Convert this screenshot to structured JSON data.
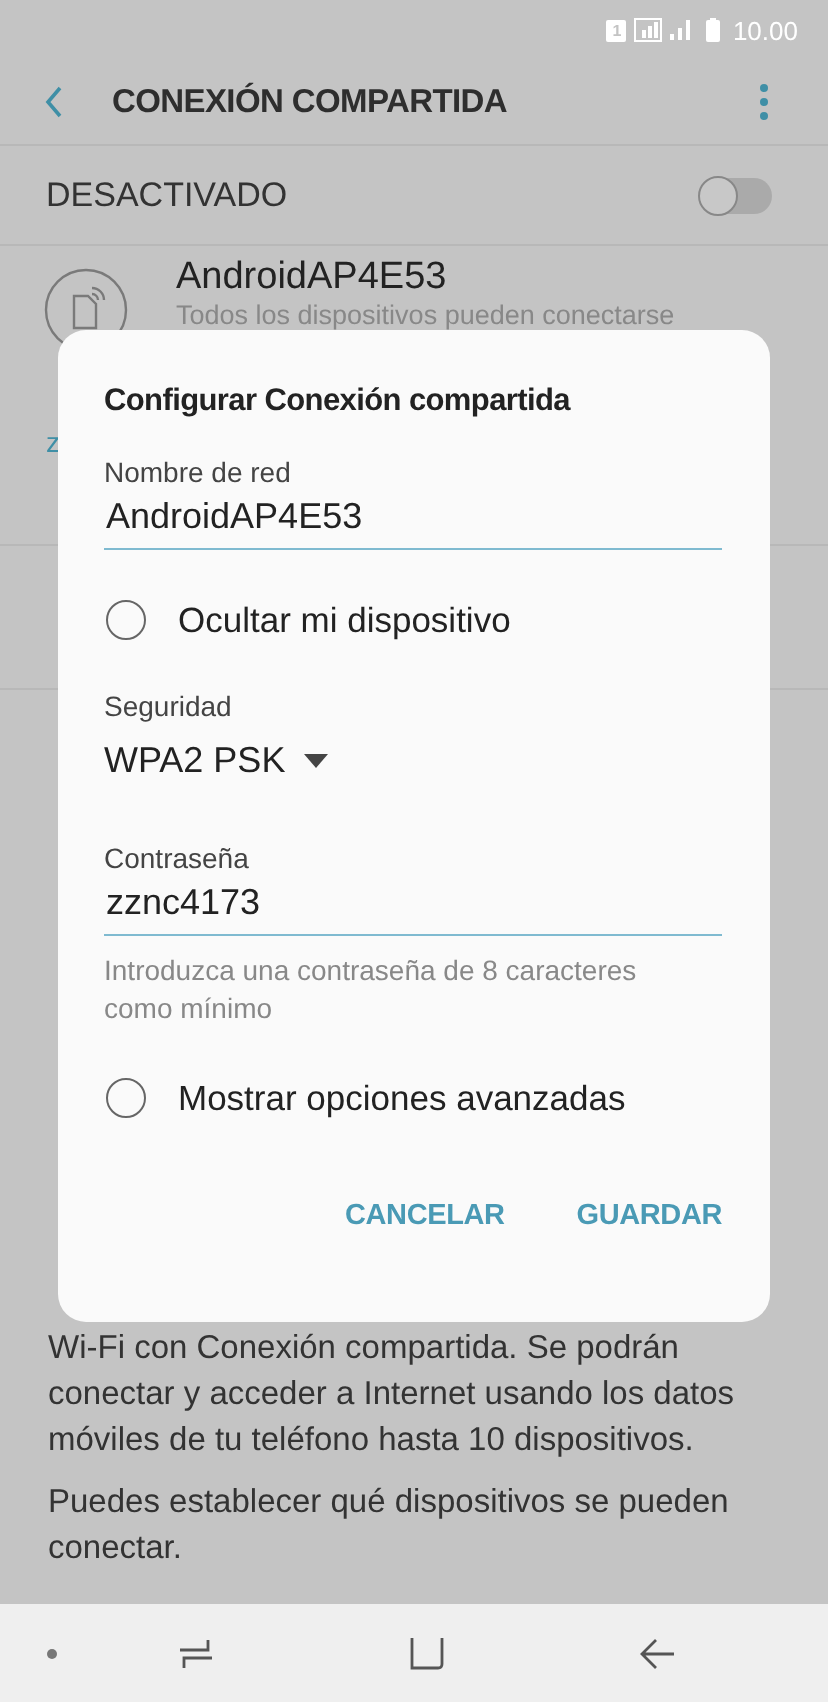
{
  "status_bar": {
    "time": "10.00",
    "sim": "1"
  },
  "header": {
    "title": "CONEXIÓN COMPARTIDA"
  },
  "master_switch": {
    "label": "DESACTIVADO",
    "on": false
  },
  "network": {
    "name": "AndroidAP4E53",
    "subtitle": "Todos los dispositivos pueden conectarse"
  },
  "rows": [
    {
      "subtitle": "z",
      "kind": "link"
    }
  ],
  "description": {
    "lines": [
      "Wi-Fi con Conexión compartida. Se podrán",
      "conectar y acceder a Internet usando los datos",
      "móviles de tu teléfono hasta 10 dispositivos."
    ],
    "note": "Puedes establecer qué dispositivos se pueden conectar."
  },
  "dialog": {
    "title": "Configurar Conexión compartida",
    "fields": [
      {
        "kind": "text",
        "label": "Nombre de red",
        "value": "AndroidAP4E53"
      },
      {
        "kind": "radio",
        "label": "Ocultar mi dispositivo",
        "checked": false
      },
      {
        "kind": "dropdown",
        "label": "Seguridad",
        "value": "WPA2 PSK"
      },
      {
        "kind": "text",
        "label": "Contraseña",
        "value": "zznc4173",
        "hint": "Introduzca una contraseña de 8 caracteres como mínimo"
      },
      {
        "kind": "radio",
        "label": "Mostrar opciones avanzadas",
        "checked": false
      }
    ],
    "buttons": [
      "CANCELAR",
      "GUARDAR"
    ]
  }
}
